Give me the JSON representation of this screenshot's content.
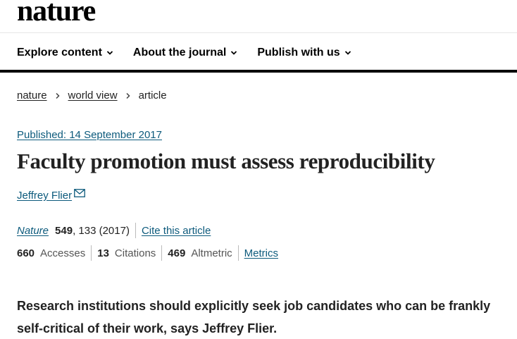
{
  "brand": {
    "logo": "nature"
  },
  "nav": {
    "items": [
      {
        "label": "Explore content",
        "icon": "chevron-down-icon"
      },
      {
        "label": "About the journal",
        "icon": "chevron-down-icon"
      },
      {
        "label": "Publish with us",
        "icon": "chevron-down-icon"
      }
    ]
  },
  "breadcrumb": {
    "items": [
      "nature",
      "world view",
      "article"
    ]
  },
  "article": {
    "published": "Published: 14 September 2017",
    "title": "Faculty promotion must assess reproducibility",
    "author": "Jeffrey Flier",
    "journal": "Nature",
    "volume": "549",
    "pages_year": ", 133 (2017)",
    "cite_label": "Cite this article",
    "standfirst": "Research institutions should explicitly seek job candidates who can be frankly self-critical of their work, says Jeffrey Flier."
  },
  "metrics": {
    "accesses_value": "660",
    "accesses_label": "Accesses",
    "citations_value": "13",
    "citations_label": "Citations",
    "altmetric_value": "469",
    "altmetric_label": "Altmetric",
    "metrics_link": "Metrics"
  },
  "colors": {
    "link": "#0c5a7c",
    "text": "#222222",
    "nav_bar": "#000000"
  }
}
